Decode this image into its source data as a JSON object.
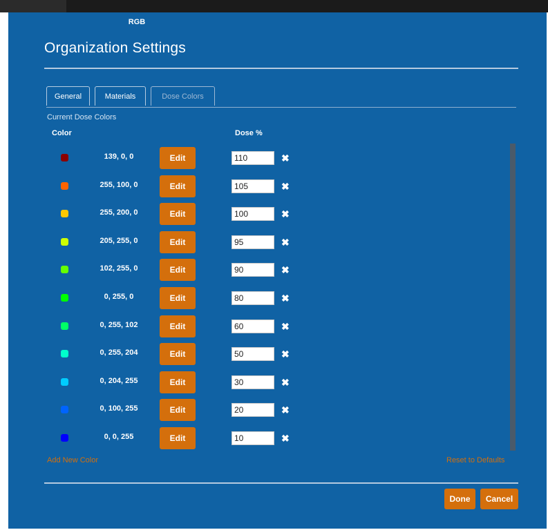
{
  "dialog": {
    "title": "Organization Settings",
    "tabs": [
      {
        "label": "General"
      },
      {
        "label": "Materials"
      },
      {
        "label": "Dose Colors"
      }
    ],
    "section_label": "Current Dose Colors",
    "columns": {
      "color": "Color",
      "rgb": "RGB",
      "dose": "Dose %"
    },
    "edit_label": "Edit",
    "remove_glyph": "✖",
    "rows": [
      {
        "rgb": "139, 0, 0",
        "color": "#8b0000",
        "dose": "110"
      },
      {
        "rgb": "255, 100, 0",
        "color": "#ff6400",
        "dose": "105"
      },
      {
        "rgb": "255, 200, 0",
        "color": "#ffc800",
        "dose": "100"
      },
      {
        "rgb": "205, 255, 0",
        "color": "#cdff00",
        "dose": "95"
      },
      {
        "rgb": "102, 255, 0",
        "color": "#66ff00",
        "dose": "90"
      },
      {
        "rgb": "0, 255, 0",
        "color": "#00ff00",
        "dose": "80"
      },
      {
        "rgb": "0, 255, 102",
        "color": "#00ff66",
        "dose": "60"
      },
      {
        "rgb": "0, 255, 204",
        "color": "#00ffcc",
        "dose": "50"
      },
      {
        "rgb": "0, 204, 255",
        "color": "#00ccff",
        "dose": "30"
      },
      {
        "rgb": "0, 100, 255",
        "color": "#0064ff",
        "dose": "20"
      },
      {
        "rgb": "0, 0, 255",
        "color": "#0000ff",
        "dose": "10"
      }
    ],
    "add_new_color": "Add New Color",
    "reset_to_defaults": "Reset to Defaults",
    "done_label": "Done",
    "cancel_label": "Cancel",
    "colors": {
      "background": "#1062a4",
      "accent": "#d46f0c"
    }
  }
}
